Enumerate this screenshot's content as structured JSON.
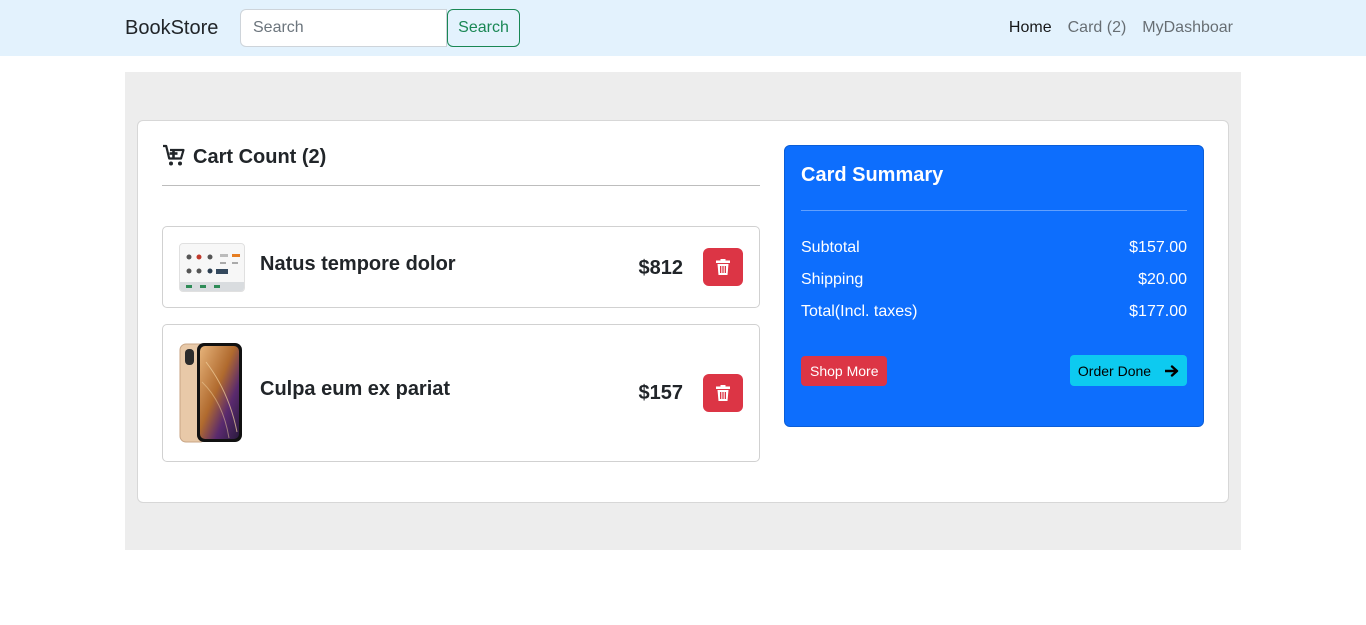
{
  "navbar": {
    "brand": "BookStore",
    "search_placeholder": "Search",
    "search_button": "Search",
    "links": [
      {
        "label": "Home",
        "active": true
      },
      {
        "label": "Card (2)",
        "active": false
      },
      {
        "label": "MyDashboar",
        "active": false
      }
    ]
  },
  "cart": {
    "title": "Cart Count (2)",
    "icon": "cart-plus-icon",
    "items": [
      {
        "name": "Natus tempore dolor",
        "price": "$812",
        "thumbnail": "headphones-catalog-image",
        "delete_icon": "trash-icon"
      },
      {
        "name": "Culpa eum ex pariat",
        "price": "$157",
        "thumbnail": "smartphone-image",
        "delete_icon": "trash-icon"
      }
    ]
  },
  "summary": {
    "title": "Card Summary",
    "rows": [
      {
        "label": "Subtotal",
        "value": "$157.00"
      },
      {
        "label": "Shipping",
        "value": "$20.00"
      },
      {
        "label": "Total(Incl. taxes)",
        "value": "$177.00"
      }
    ],
    "shop_more": "Shop More",
    "order_done": "Order Done",
    "order_done_icon": "arrow-right-icon"
  },
  "colors": {
    "navbar_bg": "#e3f2fd",
    "primary": "#0d6efd",
    "danger": "#dc3545",
    "info": "#0dcaf0",
    "success": "#198754",
    "section_bg": "#ededed"
  }
}
